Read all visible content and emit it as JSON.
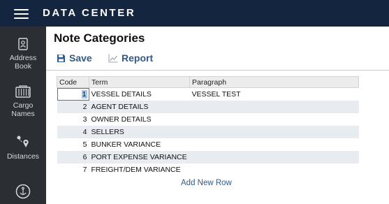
{
  "header": {
    "title": "DATA CENTER"
  },
  "sidebar": {
    "items": [
      {
        "label": "Address Book",
        "icon": "address-book-icon"
      },
      {
        "label": "Cargo Names",
        "icon": "cargo-icon"
      },
      {
        "label": "Distances",
        "icon": "distances-icon"
      },
      {
        "label": "",
        "icon": "anchor-icon"
      }
    ]
  },
  "page": {
    "title": "Note Categories"
  },
  "toolbar": {
    "save_label": "Save",
    "report_label": "Report"
  },
  "grid": {
    "columns": [
      "Code",
      "Term",
      "Paragraph"
    ],
    "rows": [
      {
        "code": "1",
        "term": "VESSEL DETAILS",
        "paragraph": "VESSEL TEST"
      },
      {
        "code": "2",
        "term": "AGENT DETAILS",
        "paragraph": ""
      },
      {
        "code": "3",
        "term": "OWNER DETAILS",
        "paragraph": ""
      },
      {
        "code": "4",
        "term": "SELLERS",
        "paragraph": ""
      },
      {
        "code": "5",
        "term": "BUNKER VARIANCE",
        "paragraph": ""
      },
      {
        "code": "6",
        "term": "PORT EXPENSE VARIANCE",
        "paragraph": ""
      },
      {
        "code": "7",
        "term": "FREIGHT/DEM VARIANCE",
        "paragraph": ""
      }
    ],
    "add_row_label": "Add New Row"
  },
  "colors": {
    "topbar": "#13253f",
    "sidebar": "#2b2f33",
    "accent": "#305a87",
    "row_alt": "#e8ebf0"
  }
}
